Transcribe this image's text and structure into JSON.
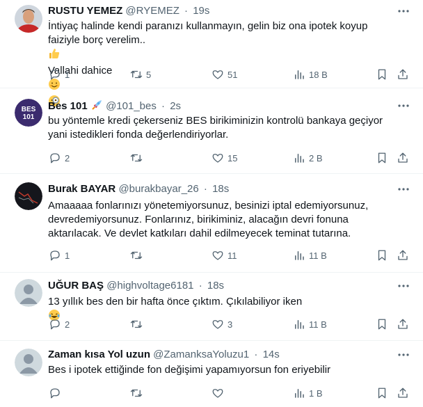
{
  "tweets": [
    {
      "name": "RUSTU YEMEZ",
      "handle": "@RYEMEZ",
      "dot": "·",
      "time": "19s",
      "lines": [
        "İntiyaç halinde kendi paranızı kullanmayın, gelin biz ona ipotek koyup",
        "faiziyle borç verelim..",
        "Vallahi dahice"
      ],
      "replies": "1",
      "retweets": "5",
      "likes": "51",
      "views": "18 B"
    },
    {
      "name": "Bes 101",
      "handle": "@101_bes",
      "dot": "·",
      "time": "2s",
      "avatar_text": "BES\n101",
      "lines": [
        "bu yöntemle kredi çekerseniz BES birikiminizin kontrolü bankaya geçiyor",
        "yani istedikleri fonda değerlendiriyorlar."
      ],
      "replies": "2",
      "retweets": "",
      "likes": "15",
      "views": "2 B"
    },
    {
      "name": "Burak BAYAR",
      "handle": "@burakbayar_26",
      "dot": "·",
      "time": "18s",
      "lines": [
        "Amaaaaa fonlarınızı yönetemiyorsunuz, besinizi iptal edemiyorsunuz,",
        "devredemiyorsunuz. Fonlarınız, birikiminiz, alacağın devri fonuna",
        "aktarılacak. Ve devlet katkıları dahil edilmeyecek teminat tutarına."
      ],
      "replies": "1",
      "retweets": "",
      "likes": "11",
      "views": "11 B"
    },
    {
      "name": "UĞUR BAŞ",
      "handle": "@highvoltage6181",
      "dot": "·",
      "time": "18s",
      "lines": [
        "13 yıllık bes den bir hafta önce çıktım. Çıkılabiliyor iken"
      ],
      "replies": "2",
      "retweets": "",
      "likes": "3",
      "views": "11 B"
    },
    {
      "name": "Zaman kısa Yol uzun",
      "handle": "@ZamanksaYoluzu1",
      "dot": "·",
      "time": "14s",
      "lines": [
        "Bes i ipotek ettiğinde fon değişimi yapamıyorsun fon eriyebilir"
      ],
      "replies": "",
      "retweets": "",
      "likes": "",
      "views": "1 B"
    }
  ],
  "colors": {
    "text": "#0f1419",
    "secondary": "#536471",
    "divider": "#eff3f4",
    "bes_avatar": "#3b2b6e",
    "default_avatar": "#cfd9de"
  },
  "icons": [
    "more-icon",
    "rocket-icon",
    "reply-icon",
    "retweet-icon",
    "like-icon",
    "views-icon",
    "bookmark-icon",
    "share-icon",
    "smile-emoji",
    "magnifier-emoji",
    "thumbs-up-emoji",
    "laughing-tears-emoji"
  ]
}
